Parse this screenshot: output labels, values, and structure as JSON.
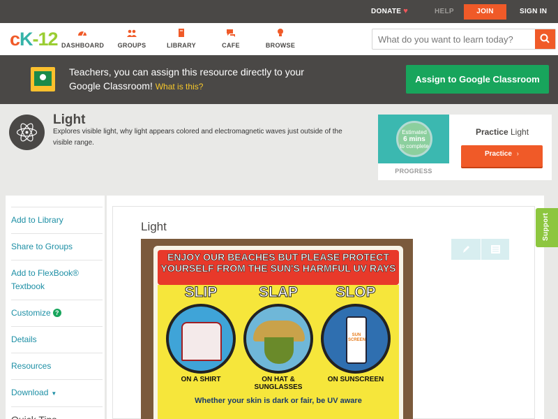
{
  "topbar": {
    "donate": "DONATE",
    "help": "HELP",
    "join": "JOIN",
    "signin": "SIGN IN"
  },
  "nav": {
    "logo_c": "c",
    "logo_k": "K",
    "logo_n": "-12",
    "items": [
      {
        "label": "DASHBOARD",
        "icon": "dashboard-icon"
      },
      {
        "label": "GROUPS",
        "icon": "groups-icon"
      },
      {
        "label": "LIBRARY",
        "icon": "library-icon"
      },
      {
        "label": "CAFE",
        "icon": "cafe-icon"
      },
      {
        "label": "BROWSE",
        "icon": "browse-icon"
      }
    ],
    "search_placeholder": "What do you want to learn today?"
  },
  "banner": {
    "text": "Teachers, you can assign this resource directly to your Google Classroom!",
    "what_link": "What is this?",
    "assign_button": "Assign to Google Classroom"
  },
  "concept": {
    "title": "Light",
    "description": "Explores visible light, why light appears colored and electromagnetic waves just outside of the visible range."
  },
  "practice": {
    "estimated": "Estimated",
    "mins": "6 mins",
    "to_complete": "to complete",
    "progress_label": "PROGRESS",
    "title_bold": "Practice",
    "title_rest": "Light",
    "button": "Practice"
  },
  "sidebar": {
    "items": [
      {
        "label": "Add to Library"
      },
      {
        "label": "Share to Groups"
      },
      {
        "label": "Add to FlexBook® Textbook"
      },
      {
        "label": "Customize"
      },
      {
        "label": "Details"
      },
      {
        "label": "Resources"
      },
      {
        "label": "Download"
      }
    ],
    "quick_tips": "Quick Tips"
  },
  "main": {
    "title": "Light",
    "support": "Support"
  },
  "sign": {
    "heading": "ENJOY OUR BEACHES BUT PLEASE PROTECT YOURSELF FROM THE SUN'S HARMFUL UV RAYS",
    "slip": "SLIP",
    "slap": "SLAP",
    "slop": "SLOP",
    "slip_caption": "ON A SHIRT",
    "slap_caption": "ON HAT & SUNGLASSES",
    "slop_caption": "ON SUNSCREEN",
    "bottle_label": "SUN SCREEN",
    "footer": "Whether your skin is dark or fair, be UV aware"
  },
  "colors": {
    "accent": "#f05a28",
    "teal": "#36b3a8",
    "green": "#18a55c",
    "dark": "#4a4846",
    "link": "#1d8fa5"
  }
}
